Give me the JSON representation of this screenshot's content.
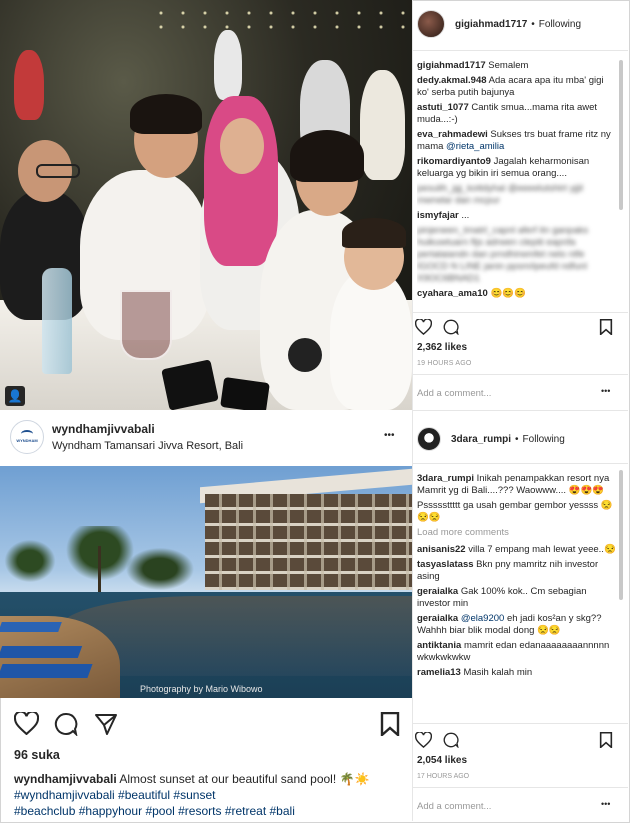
{
  "post1": {
    "author": "gigiahmad1717",
    "follow_sep": "•",
    "follow_label": "Following",
    "comments": [
      {
        "user": "gigiahmad1717",
        "text": "Semalem"
      },
      {
        "user": "dedy.akmal.948",
        "text": "Ada acara apa itu mba' gigi ko' serba putih bajunya"
      },
      {
        "user": "astuti_1077",
        "text": "Cantik smua...mama rita awet muda...:-)"
      },
      {
        "user": "eva_rahmadewi",
        "text": "Sukses trs buat frame ritz ny mama",
        "mention": "@rieta_amilia"
      },
      {
        "user": "rikomardiyanto9",
        "text": "Jagalah keharmonisan keluarga yg bikin iri semua orang...."
      },
      {
        "user": "ismyfajar",
        "text": "..."
      },
      {
        "user": "cyahara_ama10",
        "text": "😊😊😊"
      }
    ],
    "blurred_line_1": "pesulih_jgj_kottdyhal @eeeelutshtrt yjjil mwrwlar dan mcpur",
    "blurred_line_2": "pinjeneen_tmatrl_capnl aferf itn ganpaks huikuwtuarn ftjs adrwen clepiti eapnfa pertalaiandn dan prndhirwmfet nelo ntfe IGOCD N LINE janin ppsm/ipeufd ndfunl X9OC6BNAD1",
    "likes": "2,362 likes",
    "time": "19 HOURS AGO",
    "add_comment": "Add a comment...",
    "more": "•••"
  },
  "post2": {
    "author": "wyndhamjivvabali",
    "location": "Wyndham Tamansari Jivva Resort, Bali",
    "more": "•••",
    "photo_credit": "Photography by Mario Wibowo",
    "likes": "96 suka",
    "caption_user": "wyndhamjivvabali",
    "caption_text": "Almost sunset at our beautiful sand pool! 🌴☀️",
    "hashtags_1": "#wyndhamjivvabali #beautiful #sunset",
    "hashtags_2": "#beachclub #happyhour #pool #resorts #retreat #bali",
    "logo_text": "WYNDHAM"
  },
  "post3": {
    "author": "3dara_rumpi",
    "follow_sep": "•",
    "follow_label": "Following",
    "caption_user": "3dara_rumpi",
    "caption_text": "Inikah penampakkan resort nya Mamrit yg di Bali....??? Waowww.... 😍😍😍",
    "first_comment_user": "Psssssttttt",
    "first_comment_text": "ga usah gembar gembor yessss 😒😒😒",
    "load_more": "Load more comments",
    "comments": [
      {
        "user": "anisanis22",
        "text": "villa 7 empang mah lewat yeee..😒"
      },
      {
        "user": "tasyaslatass",
        "text": "Bkn pny mamritz nih investor asing"
      },
      {
        "user": "geraialka",
        "text": "Gak 100% kok.. Cm sebagian investor min"
      },
      {
        "user": "geraialka",
        "mention": "@ela9200",
        "text": "eh jadi kos²an y skg?? Wahhh biar blik modal dong 😒😒"
      },
      {
        "user": "antiktania",
        "text": "mamrit edan edanaaaaaaaannnnn wkwkwkwkw"
      },
      {
        "user": "ramelia13",
        "text": "Masih kalah min"
      }
    ],
    "likes": "2,054 likes",
    "time": "17 HOURS AGO",
    "add_comment": "Add a comment...",
    "more": "•••"
  },
  "colors": {
    "pink_hijab": "#d94a86",
    "mention": "#003569",
    "muted": "#999999",
    "divider": "#e6e6e6"
  }
}
